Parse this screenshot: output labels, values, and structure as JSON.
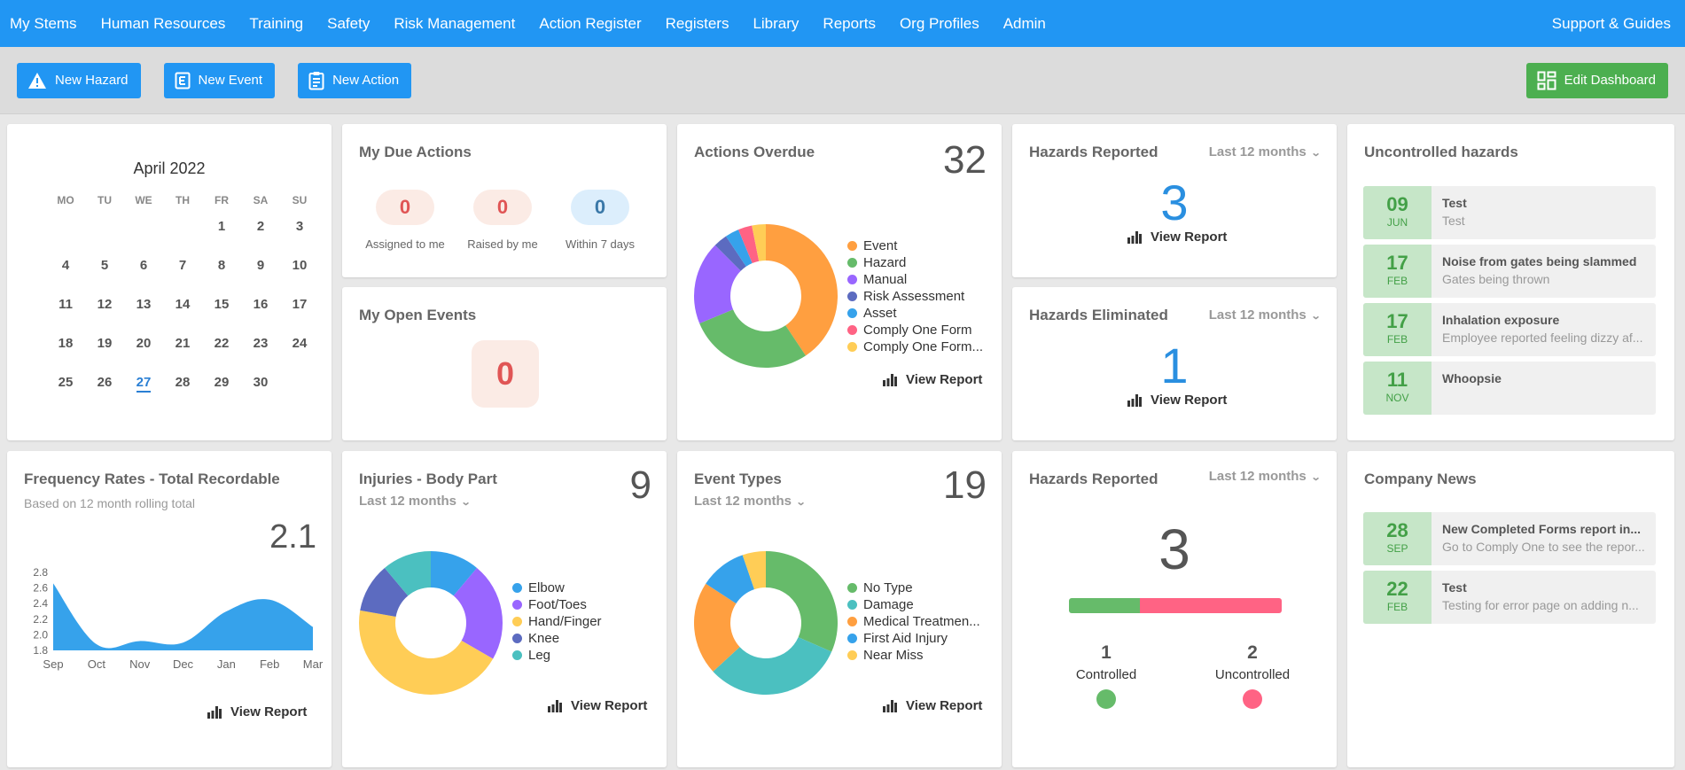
{
  "nav": {
    "items": [
      "My Stems",
      "Human Resources",
      "Training",
      "Safety",
      "Risk Management",
      "Action Register",
      "Registers",
      "Library",
      "Reports",
      "Org Profiles",
      "Admin"
    ],
    "right": "Support & Guides"
  },
  "toolbar": {
    "new_hazard": "New Hazard",
    "new_event": "New Event",
    "new_action": "New Action",
    "edit_dashboard": "Edit Dashboard"
  },
  "calendar": {
    "title": "April 2022",
    "weekdays": [
      "MO",
      "TU",
      "WE",
      "TH",
      "FR",
      "SA",
      "SU"
    ],
    "start_offset": 4,
    "days_in_month": 30,
    "today": 27
  },
  "due_actions": {
    "title": "My Due Actions",
    "items": [
      {
        "value": "0",
        "label": "Assigned to me",
        "tone": "red"
      },
      {
        "value": "0",
        "label": "Raised by me",
        "tone": "red"
      },
      {
        "value": "0",
        "label": "Within 7 days",
        "tone": "blue"
      }
    ]
  },
  "open_events": {
    "title": "My Open Events",
    "value": "0"
  },
  "actions_overdue": {
    "title": "Actions Overdue",
    "total": "32",
    "view_report": "View Report"
  },
  "hazards_reported_top": {
    "title": "Hazards Reported",
    "period": "Last 12 months",
    "value": "3",
    "view_report": "View Report"
  },
  "hazards_eliminated": {
    "title": "Hazards Eliminated",
    "period": "Last 12 months",
    "value": "1",
    "view_report": "View Report"
  },
  "uncontrolled": {
    "title": "Uncontrolled hazards",
    "items": [
      {
        "day": "09",
        "month": "JUN",
        "title": "Test",
        "desc": "Test"
      },
      {
        "day": "17",
        "month": "FEB",
        "title": "Noise from gates being slammed",
        "desc": "Gates being thrown"
      },
      {
        "day": "17",
        "month": "FEB",
        "title": "Inhalation exposure",
        "desc": "Employee reported feeling dizzy af..."
      },
      {
        "day": "11",
        "month": "NOV",
        "title": "Whoopsie",
        "desc": ""
      }
    ]
  },
  "frequency": {
    "title": "Frequency Rates - Total Recordable",
    "subtitle": "Based on 12 month rolling total",
    "value": "2.1",
    "view_report": "View Report"
  },
  "injuries": {
    "title": "Injuries - Body Part",
    "period": "Last 12 months",
    "total": "9",
    "view_report": "View Report"
  },
  "event_types": {
    "title": "Event Types",
    "period": "Last 12 months",
    "total": "19",
    "view_report": "View Report"
  },
  "hazards_reported_bottom": {
    "title": "Hazards Reported",
    "period": "Last 12 months",
    "value": "3",
    "controlled": {
      "value": "1",
      "label": "Controlled",
      "color": "#66bb6a"
    },
    "uncontrolled": {
      "value": "2",
      "label": "Uncontrolled",
      "color": "#ff6384"
    }
  },
  "news": {
    "title": "Company News",
    "items": [
      {
        "day": "28",
        "month": "SEP",
        "title": "New Completed Forms report in...",
        "desc": "Go to Comply One to see the repor..."
      },
      {
        "day": "22",
        "month": "FEB",
        "title": "Test",
        "desc": "Testing for error page on adding n..."
      }
    ]
  },
  "chart_data": [
    {
      "type": "pie",
      "id": "actions_overdue",
      "title": "Actions Overdue",
      "labels": [
        "Event",
        "Hazard",
        "Manual",
        "Risk Assessment",
        "Asset",
        "Comply One Form",
        "Comply One Form..."
      ],
      "values": [
        13,
        9,
        6,
        1,
        1,
        1,
        1
      ],
      "colors": [
        "#ff9f40",
        "#66bb6a",
        "#9966ff",
        "#5c6bc0",
        "#36a2eb",
        "#ff6384",
        "#ffcd56"
      ],
      "donut": true,
      "legend": "right"
    },
    {
      "type": "pie",
      "id": "injuries",
      "title": "Injuries - Body Part",
      "labels": [
        "Elbow",
        "Foot/Toes",
        "Hand/Finger",
        "Knee",
        "Leg"
      ],
      "values": [
        1,
        2,
        4,
        1,
        1
      ],
      "colors": [
        "#36a2eb",
        "#9966ff",
        "#ffcd56",
        "#5c6bc0",
        "#4bc0c0"
      ],
      "donut": true,
      "legend": "right"
    },
    {
      "type": "pie",
      "id": "event_types",
      "title": "Event Types",
      "labels": [
        "No Type",
        "Damage",
        "Medical Treatmen...",
        "First Aid Injury",
        "Near Miss"
      ],
      "values": [
        6,
        6,
        4,
        2,
        1
      ],
      "colors": [
        "#66bb6a",
        "#4bc0c0",
        "#ff9f40",
        "#36a2eb",
        "#ffcd56"
      ],
      "donut": true,
      "legend": "right"
    },
    {
      "type": "area",
      "id": "frequency",
      "title": "Frequency Rates - Total Recordable",
      "categories": [
        "Sep",
        "Oct",
        "Nov",
        "Dec",
        "Jan",
        "Feb",
        "Mar"
      ],
      "values": [
        2.66,
        1.88,
        1.92,
        1.9,
        2.3,
        2.45,
        2.1
      ],
      "yticks": [
        "2.8",
        "2.6",
        "2.4",
        "2.2",
        "2.0",
        "1.8"
      ],
      "ylim": [
        1.8,
        2.8
      ],
      "color": "#36a2eb",
      "grid": false
    },
    {
      "type": "bar",
      "id": "hazards_controlled_split",
      "categories": [
        "Controlled",
        "Uncontrolled"
      ],
      "values": [
        1,
        2
      ],
      "colors": [
        "#66bb6a",
        "#ff6384"
      ],
      "stacked": true
    }
  ]
}
